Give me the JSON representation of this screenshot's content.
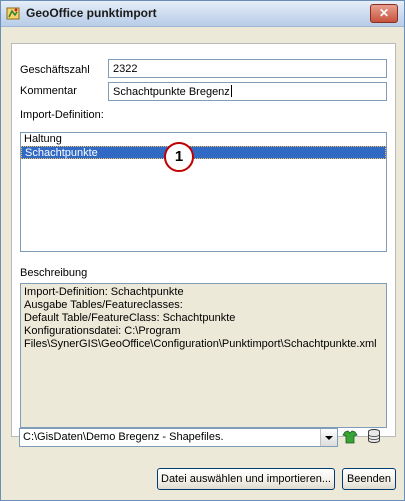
{
  "window": {
    "title": "GeoOffice punktimport",
    "close_glyph": "✕"
  },
  "form": {
    "geschaeftszahl_label": "Geschäftszahl",
    "geschaeftszahl_value": "2322",
    "kommentar_label": "Kommentar",
    "kommentar_value": "Schachtpunkte Bregenz",
    "import_label": "Import-Definition:",
    "import_items": [
      "Haltung",
      "Schachtpunkte"
    ],
    "selected_index": 1,
    "callout": "1",
    "beschreibung_label": "Beschreibung",
    "beschreibung_lines": [
      "Import-Definition: Schachtpunkte",
      "Ausgabe Tables/Featureclasses:",
      "Default Table/FeatureClass: Schachtpunkte",
      "Konfigurationsdatei: C:\\Program",
      "Files\\SynerGIS\\GeoOffice\\Configuration\\Punktimport\\Schachtpunkte.xml"
    ]
  },
  "footer": {
    "workspace_value": "C:\\GisDaten\\Demo Bregenz - Shapefiles.",
    "import_button": "Datei auswählen und importieren...",
    "close_button": "Beenden"
  },
  "icons": {
    "app": "app-icon",
    "workspace_add": "green-shirt-icon",
    "database": "database-icon"
  }
}
